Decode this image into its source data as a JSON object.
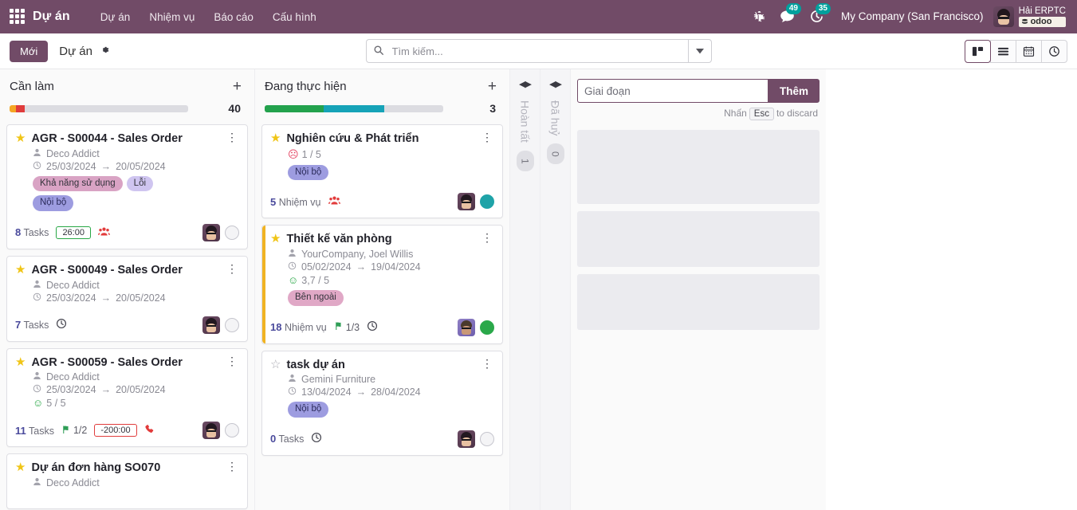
{
  "navbar": {
    "brand": "Dự án",
    "apps_icon": "apps-grid-icon",
    "menu": [
      "Dự án",
      "Nhiệm vụ",
      "Báo cáo",
      "Cấu hình"
    ],
    "bug_icon": "bug-icon",
    "messages": {
      "icon": "chat-icon",
      "count": "49"
    },
    "activities": {
      "icon": "clock-icon",
      "count": "35"
    },
    "company": "My Company (San Francisco)",
    "user_name": "Hải ERPTC",
    "database": "odoo"
  },
  "control_panel": {
    "new_label": "Mới",
    "breadcrumb": "Dự án",
    "gear_icon": "gear-icon",
    "search_placeholder": "Tìm kiếm...",
    "search_value": "",
    "views": [
      {
        "name": "kanban",
        "icon": "kanban-icon",
        "active": true
      },
      {
        "name": "list",
        "icon": "list-icon",
        "active": false
      },
      {
        "name": "calendar",
        "icon": "calendar-icon",
        "active": false
      },
      {
        "name": "activity",
        "icon": "clock-icon",
        "active": false
      }
    ]
  },
  "columns": [
    {
      "title": "Cần làm",
      "count": "40",
      "progress": [
        {
          "color": "#f5a623",
          "pct": 3
        },
        {
          "color": "#e03c3c",
          "pct": 5
        }
      ],
      "cards": [
        {
          "starred": true,
          "title": "AGR - S00044 - Sales Order",
          "partner": "Deco Addict",
          "date_start": "25/03/2024",
          "date_end": "20/05/2024",
          "rating": null,
          "tags": [
            {
              "label": "Khả năng sử dụng",
              "bg": "#d9a3c4",
              "fg": "#33333b"
            },
            {
              "label": "Lỗi",
              "bg": "#cfc5f0",
              "fg": "#33333b"
            },
            {
              "label": "Nội bộ",
              "bg": "#9d9ce0",
              "fg": "#2b2b5b"
            }
          ],
          "tasks_count": "8",
          "tasks_label": "Tasks",
          "flag": null,
          "time_badge": "26:00",
          "time_badge_negative": false,
          "footer_icon": "people-icon",
          "avatar": "user-avatar",
          "status_dot": "empty"
        },
        {
          "starred": true,
          "title": "AGR - S00049 - Sales Order",
          "partner": "Deco Addict",
          "date_start": "25/03/2024",
          "date_end": "20/05/2024",
          "rating": null,
          "tags": [],
          "tasks_count": "7",
          "tasks_label": "Tasks",
          "flag": null,
          "time_badge": null,
          "footer_icon": "clock-icon",
          "avatar": "user-avatar",
          "status_dot": "empty"
        },
        {
          "starred": true,
          "title": "AGR - S00059 - Sales Order",
          "partner": "Deco Addict",
          "date_start": "25/03/2024",
          "date_end": "20/05/2024",
          "rating": {
            "face": "happy",
            "value": "5 / 5"
          },
          "tags": [],
          "tasks_count": "11",
          "tasks_label": "Tasks",
          "flag": "1/2",
          "time_badge": "-200:00",
          "time_badge_negative": true,
          "footer_icon": "phone-icon",
          "avatar": "user-avatar",
          "status_dot": "empty"
        },
        {
          "starred": true,
          "title": "Dự án đơn hàng SO070",
          "partner": "Deco Addict",
          "date_start": null,
          "date_end": null,
          "rating": null,
          "tags": [],
          "tasks_count": null,
          "tasks_label": null,
          "flag": null,
          "time_badge": null,
          "footer_icon": null,
          "avatar": null,
          "status_dot": null
        }
      ]
    },
    {
      "title": "Đang thực hiện",
      "count": "3",
      "progress": [
        {
          "color": "#23a24d",
          "pct": 32
        },
        {
          "color": "#16a3b8",
          "pct": 34
        }
      ],
      "cards": [
        {
          "starred": true,
          "title": "Nghiên cứu & Phát triển",
          "partner": null,
          "date_start": null,
          "date_end": null,
          "rating": {
            "face": "sad",
            "value": "1 / 5"
          },
          "tags": [
            {
              "label": "Nội bộ",
              "bg": "#9d9ce0",
              "fg": "#2b2b5b"
            }
          ],
          "tasks_count": "5",
          "tasks_label": "Nhiệm vụ",
          "flag": null,
          "time_badge": null,
          "footer_icon": "people-icon",
          "avatar": "user-avatar",
          "status_dot": "teal"
        },
        {
          "starred": true,
          "stripe": true,
          "title": "Thiết kế văn phòng",
          "partner": "YourCompany, Joel Willis",
          "date_start": "05/02/2024",
          "date_end": "19/04/2024",
          "rating": {
            "face": "happy",
            "value": "3,7 / 5"
          },
          "tags": [
            {
              "label": "Bên ngoài",
              "bg": "#e0a8c6",
              "fg": "#33333b"
            }
          ],
          "tasks_count": "18",
          "tasks_label": "Nhiệm vụ",
          "flag": "1/3",
          "time_badge": null,
          "footer_icon": "clock-icon",
          "avatar": "user-avatar-beard",
          "status_dot": "green"
        },
        {
          "starred": false,
          "title": "task dự án",
          "partner": "Gemini Furniture",
          "date_start": "13/04/2024",
          "date_end": "28/04/2024",
          "rating": null,
          "tags": [
            {
              "label": "Nội bộ",
              "bg": "#9d9ce0",
              "fg": "#2b2b5b"
            }
          ],
          "tasks_count": "0",
          "tasks_label": "Tasks",
          "flag": null,
          "time_badge": null,
          "footer_icon": "clock-icon",
          "avatar": "user-avatar",
          "status_dot": "empty"
        }
      ]
    }
  ],
  "folded_columns": [
    {
      "title": "Hoàn tất",
      "count": "1"
    },
    {
      "title": "Đã huỷ",
      "count": "0"
    }
  ],
  "new_column": {
    "placeholder": "Giai đoạn",
    "value": "",
    "add_label": "Thêm",
    "hint_prefix": "Nhấn",
    "hint_key": "Esc",
    "hint_suffix": "to discard"
  }
}
